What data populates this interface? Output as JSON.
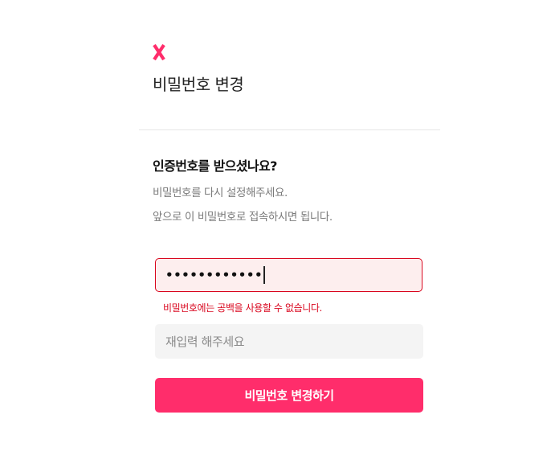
{
  "brand": {
    "logo_icon": "x-logo-icon",
    "accent_color": "#ff2d6b"
  },
  "header": {
    "title": "비밀번호 변경"
  },
  "content": {
    "heading": "인증번호를 받으셨나요?",
    "description_line1": "비밀번호를 다시 설정해주세요.",
    "description_line2": "앞으로 이 비밀번호로 접속하시면 됩니다."
  },
  "form": {
    "password_value_masked": "••••••••••••",
    "password_error": "비밀번호에는 공백을 사용할 수 없습니다.",
    "error_color": "#d9061e",
    "confirm_placeholder": "재입력 해주세요",
    "submit_label": "비밀번호 변경하기"
  }
}
